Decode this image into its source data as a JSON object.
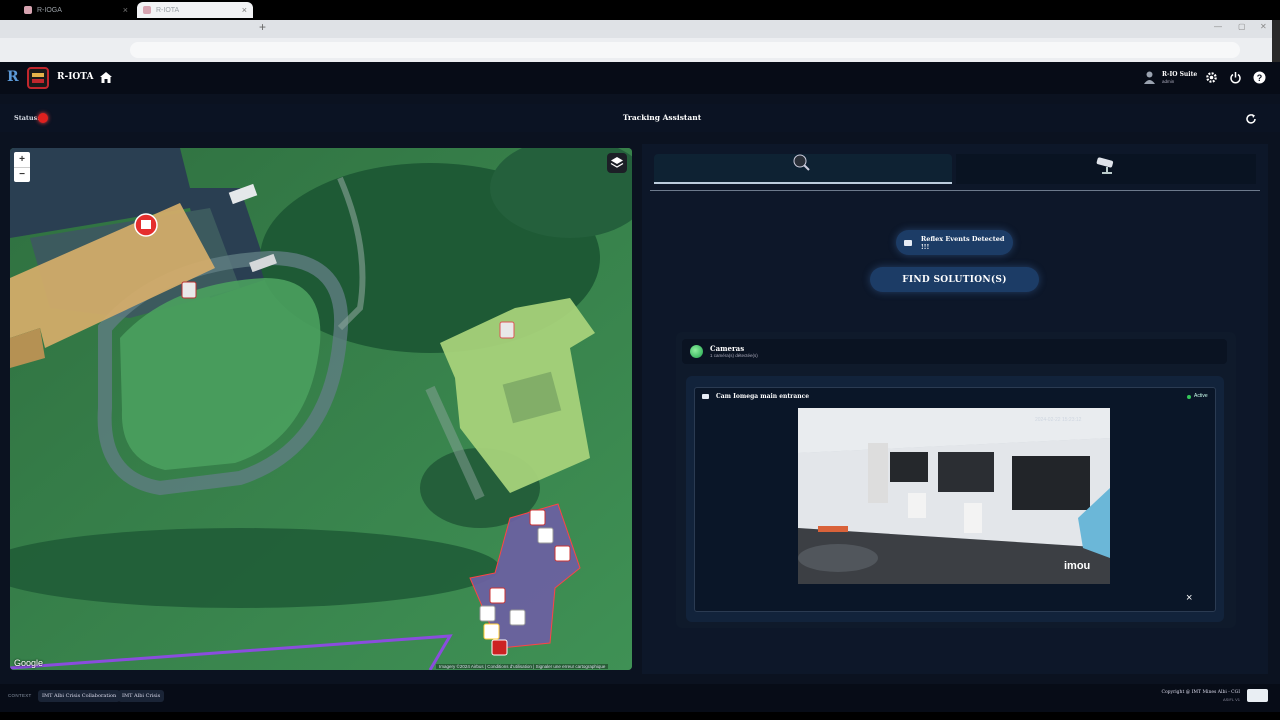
{
  "browser": {
    "tabs": [
      {
        "title": "R-IOGA",
        "active": false
      },
      {
        "title": "R-IOTA",
        "active": true
      }
    ],
    "new_tab": "+",
    "tab_close": "×"
  },
  "app": {
    "title": "R-IOTA",
    "user": {
      "name": "R-IO Suite",
      "role": "admin"
    },
    "icons": [
      "home-icon",
      "settings-icon",
      "power-icon",
      "help-icon"
    ]
  },
  "statusbar": {
    "status_label": "Status:",
    "status_color": "#e0211f",
    "center_title": "Tracking Assistant"
  },
  "map": {
    "zoom_in": "+",
    "zoom_out": "−",
    "provider": "Google",
    "attribution": "Imagery ©2024 Airbus | Conditions d'utilisation | Signaler une erreur cartographique"
  },
  "panel": {
    "tabs": [
      "tracking-tab",
      "camera-tab"
    ],
    "reflex_label": "Reflex Events Detected !!!",
    "find_button": "FIND SOLUTION(S)",
    "cameras": {
      "title": "Cameras",
      "subtitle": "1 caméra(s) détectée(s)",
      "camera_name": "Cam Iomega main entrance",
      "camera_status": "Active",
      "video_timestamp": "2024-02-22 15:23:12",
      "video_brand": "imou",
      "close": "×"
    }
  },
  "footer": {
    "context_label": "CONTEXT",
    "chips": [
      "IMT Albi Crisis Collaboration",
      "IMT Albi Crisis"
    ],
    "copyright": "Copyright @ IMT Mines Albi - CGI",
    "version": "ASIFL V1"
  }
}
